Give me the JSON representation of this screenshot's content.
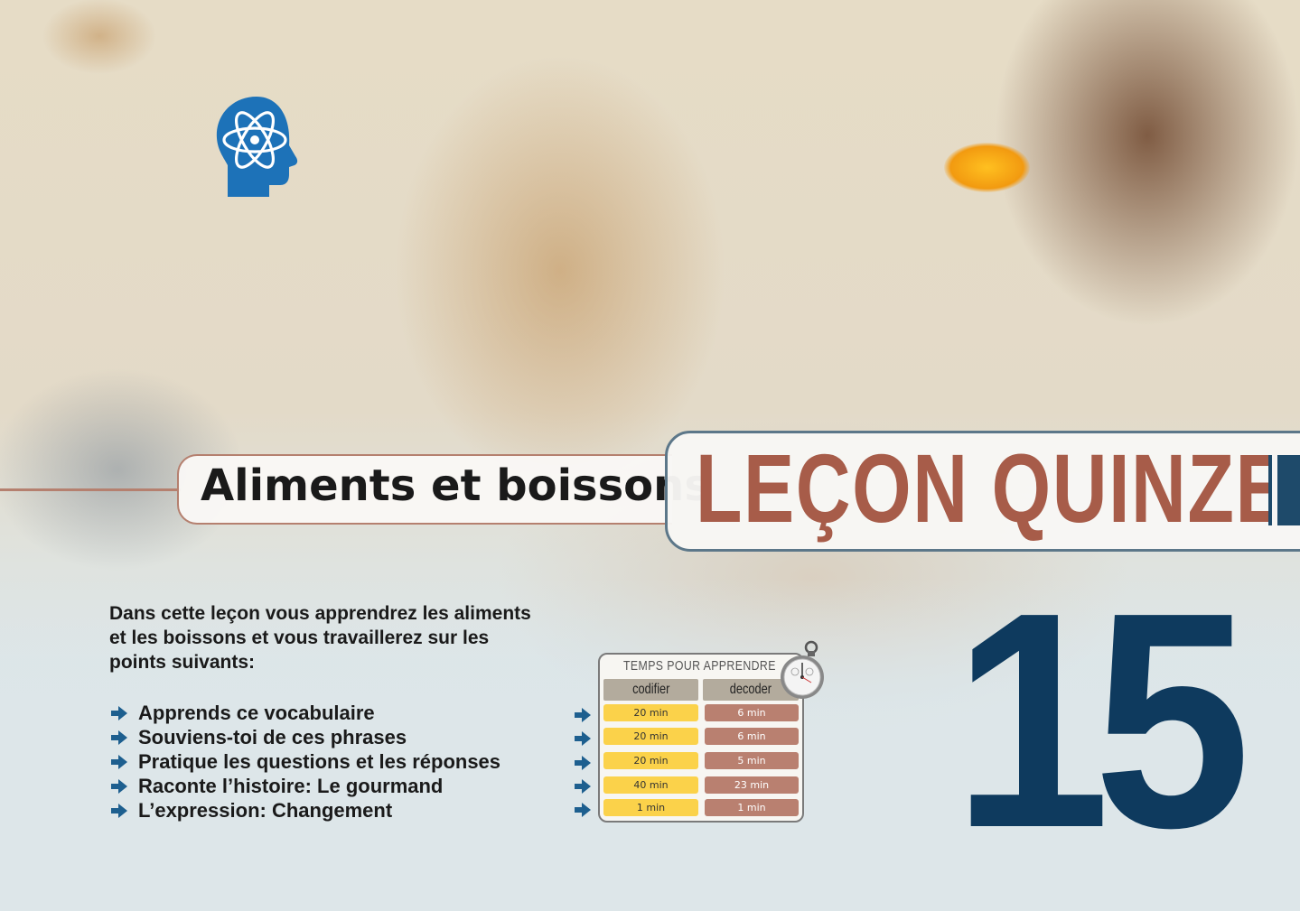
{
  "header": {
    "section_title": "Aliments et boissons",
    "lesson_title": "LEÇON QUINZE",
    "lesson_number": "15"
  },
  "intro": {
    "text": "Dans cette leçon vous apprendrez les aliments et les boissons et vous travaillerez sur les points suivants:",
    "points": [
      "Apprends ce vocabulaire",
      "Souviens-toi de ces phrases",
      "Pratique les questions et les réponses",
      "Raconte l’histoire: Le gourmand",
      "L’expression: Changement"
    ]
  },
  "time_table": {
    "title": "TEMPS POUR APPRENDRE",
    "col1_header": "codifier",
    "col2_header": "decoder",
    "rows": [
      {
        "codifier": "20 min",
        "decoder": "6 min"
      },
      {
        "codifier": "20 min",
        "decoder": "6 min"
      },
      {
        "codifier": "20 min",
        "decoder": "5 min"
      },
      {
        "codifier": "40 min",
        "decoder": "23 min"
      },
      {
        "codifier": "1 min",
        "decoder": "1 min"
      }
    ]
  },
  "icons": {
    "brain": "brain-atom-icon",
    "arrow": "arrow-right-icon",
    "stopwatch": "stopwatch-icon"
  },
  "colors": {
    "lesson_title": "#a75c49",
    "number": "#0e3a5e",
    "brain_icon": "#1d72b8",
    "arrow": "#1d5f8f",
    "codifier_cell": "#fbd24a",
    "decoder_cell": "#b98070"
  }
}
